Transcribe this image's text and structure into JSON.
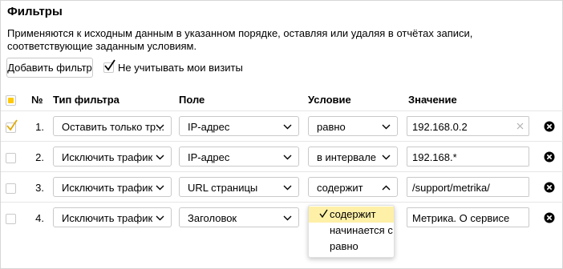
{
  "panel": {
    "title": "Фильтры",
    "description": "Применяются к исходным данным в указанном порядке, оставляя или удаляя в отчётах записи, соответствующие заданным условиям.",
    "add_filter_label": "Добавить фильтр",
    "ignore_visits_label": "Не учитывать мои визиты",
    "ignore_visits_checked": true
  },
  "table": {
    "headers": {
      "num": "№",
      "filter_type": "Тип фильтра",
      "field": "Поле",
      "condition": "Условие",
      "value": "Значение"
    },
    "rows": [
      {
        "checked": true,
        "num": "1.",
        "filter_type": "Оставить только тр...",
        "field": "IP-адрес",
        "condition": "равно",
        "value": "192.168.0.2"
      },
      {
        "checked": false,
        "num": "2.",
        "filter_type": "Исключить трафик",
        "field": "IP-адрес",
        "condition": "в интервале",
        "value": "192.168.*"
      },
      {
        "checked": false,
        "num": "3.",
        "filter_type": "Исключить трафик",
        "field": "URL страницы",
        "condition": "содержит",
        "value": "/support/metrika/"
      },
      {
        "checked": false,
        "num": "4.",
        "filter_type": "Исключить трафик",
        "field": "Заголовок",
        "condition": "",
        "value": "Метрика. О сервисе"
      }
    ]
  },
  "condition_dropdown": {
    "options": [
      "содержит",
      "начинается с",
      "равно"
    ],
    "selected": "содержит"
  },
  "colors": {
    "accent_yellow": "#ffc90a",
    "selected_option_bg": "#fff0a8",
    "border": "#c9c9c9"
  }
}
